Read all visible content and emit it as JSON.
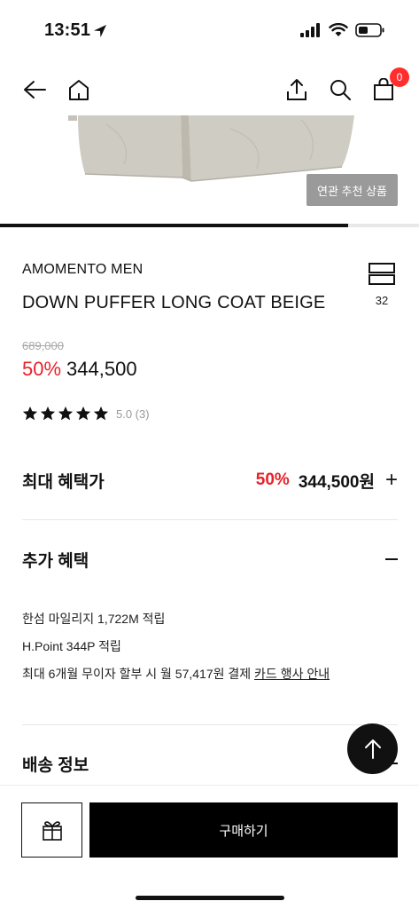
{
  "status_bar": {
    "time": "13:51"
  },
  "nav": {
    "cart_count": "0"
  },
  "hero": {
    "related_label": "연관 추천 상품",
    "progress": 0.83
  },
  "product": {
    "brand": "AMOMENTO MEN",
    "name": "DOWN PUFFER LONG COAT BEIGE",
    "like_count": "32",
    "original_price": "689,000",
    "discount": "50%",
    "price": "344,500",
    "rating_text": "5.0 (3)",
    "stars": 5
  },
  "max_benefit": {
    "title": "최대 혜택가",
    "discount": "50%",
    "price": "344,500원",
    "expand": "+"
  },
  "extra_benefit": {
    "title": "추가 혜택",
    "items": [
      "한섬 마일리지 1,722M 적립",
      "H.Point 344P 적립"
    ],
    "installment_text": "최대 6개월 무이자 할부 시 월 57,417원 결제",
    "card_link": "카드 행사 안내"
  },
  "shipping": {
    "title": "배송 정보"
  },
  "bottom": {
    "buy_label": "구매하기"
  },
  "colors": {
    "accent_red": "#e8222a",
    "badge_red": "#ff2d2d",
    "black": "#111111"
  }
}
